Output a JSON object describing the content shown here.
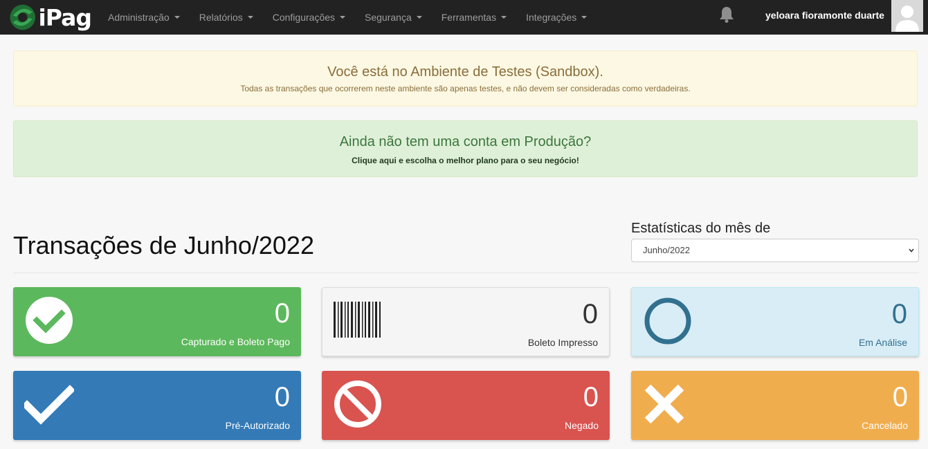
{
  "navbar": {
    "brand": "iPag",
    "menu": [
      {
        "label": "Administração"
      },
      {
        "label": "Relatórios"
      },
      {
        "label": "Configurações"
      },
      {
        "label": "Segurança"
      },
      {
        "label": "Ferramentas"
      },
      {
        "label": "Integrações"
      }
    ],
    "user_name": "yeloara fioramonte duarte"
  },
  "alerts": {
    "sandbox_title": "Você está no Ambiente de Testes (Sandbox).",
    "sandbox_text": "Todas as transações que ocorrerem neste ambiente são apenas testes, e não devem ser consideradas como verdadeiras.",
    "production_title": "Ainda não tem uma conta em Produção?",
    "production_link": "Clique aqui e escolha o melhor plano para o seu negócio!"
  },
  "page_title": "Transações de Junho/2022",
  "stats": {
    "label": "Estatísticas do mês de",
    "selected_month": "Junho/2022"
  },
  "cards": [
    {
      "count": "0",
      "label": "Capturado e Boleto Pago",
      "color": "#5cb85c",
      "icon": "check-circle-icon"
    },
    {
      "count": "0",
      "label": "Boleto Impresso",
      "color": "#f5f5f5",
      "icon": "barcode-icon"
    },
    {
      "count": "0",
      "label": "Em Análise",
      "color": "#d9edf7",
      "icon": "circle-outline-icon"
    },
    {
      "count": "0",
      "label": "Pré-Autorizado",
      "color": "#337ab7",
      "icon": "check-icon"
    },
    {
      "count": "0",
      "label": "Negado",
      "color": "#d9534f",
      "icon": "ban-icon"
    },
    {
      "count": "0",
      "label": "Cancelado",
      "color": "#f0ad4e",
      "icon": "times-icon"
    }
  ]
}
